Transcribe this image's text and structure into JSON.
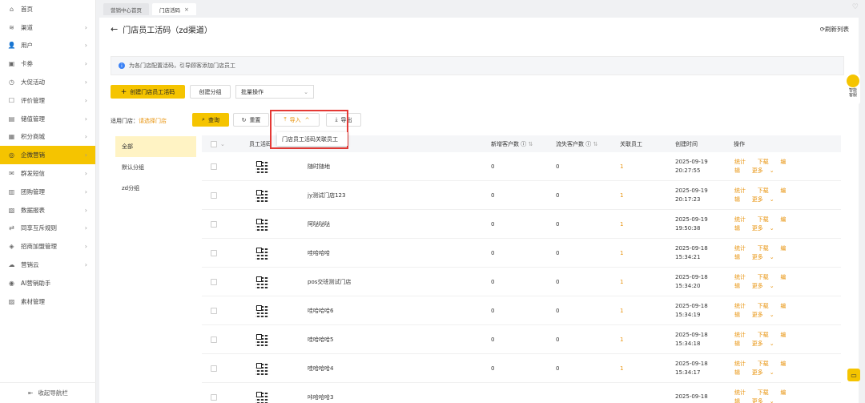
{
  "sidebar": {
    "items": [
      {
        "label": "首页",
        "icon": "home-icon",
        "chevron": false,
        "active": false
      },
      {
        "label": "渠道",
        "icon": "channel-icon",
        "chevron": true,
        "active": false
      },
      {
        "label": "用户",
        "icon": "user-icon",
        "chevron": true,
        "active": false
      },
      {
        "label": "卡券",
        "icon": "coupon-icon",
        "chevron": true,
        "active": false
      },
      {
        "label": "大促活动",
        "icon": "activity-icon",
        "chevron": true,
        "active": false
      },
      {
        "label": "评价管理",
        "icon": "review-icon",
        "chevron": true,
        "active": false
      },
      {
        "label": "储值管理",
        "icon": "wallet-icon",
        "chevron": true,
        "active": false
      },
      {
        "label": "积分商城",
        "icon": "points-icon",
        "chevron": true,
        "active": false
      },
      {
        "label": "企微营销",
        "icon": "wechat-icon",
        "chevron": true,
        "active": true
      },
      {
        "label": "群发短信",
        "icon": "sms-icon",
        "chevron": true,
        "active": false
      },
      {
        "label": "团购管理",
        "icon": "groupbuy-icon",
        "chevron": true,
        "active": false
      },
      {
        "label": "数据报表",
        "icon": "report-icon",
        "chevron": true,
        "active": false
      },
      {
        "label": "同享互斥规则",
        "icon": "rule-icon",
        "chevron": true,
        "active": false
      },
      {
        "label": "招商加盟管理",
        "icon": "franchise-icon",
        "chevron": true,
        "active": false
      },
      {
        "label": "营销云",
        "icon": "cloud-icon",
        "chevron": true,
        "active": false
      },
      {
        "label": "AI营销助手",
        "icon": "ai-icon",
        "chevron": false,
        "active": false
      },
      {
        "label": "素材管理",
        "icon": "material-icon",
        "chevron": false,
        "active": false
      }
    ],
    "footer": "收起导航栏"
  },
  "tabs": [
    {
      "label": "营销中心首页",
      "active": false
    },
    {
      "label": "门店活码",
      "active": true
    }
  ],
  "page": {
    "title": "门店员工活码（zd渠道）",
    "refresh": "刷新列表",
    "info": "为各门店配置活码，引导顾客添加门店员工"
  },
  "toolbar": {
    "create": "创建门店员工活码",
    "create_group": "创建分组",
    "batch": "批量操作",
    "filter_label": "适用门店：",
    "filter_link": "请选择门店",
    "query": "查询",
    "reset": "重置",
    "import": "导入",
    "export": "导出",
    "import_option": "门店员工活码关联员工"
  },
  "groups": [
    "全部",
    "默认分组",
    "zd分组"
  ],
  "table": {
    "headers": [
      "员工活码",
      "",
      "新增客户数",
      "流失客户数",
      "关联员工",
      "创建时间",
      "操作"
    ],
    "rows": [
      {
        "name": "随时随地",
        "new": "0",
        "lost": "0",
        "staff": "1",
        "date": "2025-09-19",
        "time": "20:27:55"
      },
      {
        "name": "jy测试门店123",
        "new": "0",
        "lost": "0",
        "staff": "1",
        "date": "2025-09-19",
        "time": "20:17:23"
      },
      {
        "name": "阿哒哒哒",
        "new": "0",
        "lost": "0",
        "staff": "1",
        "date": "2025-09-19",
        "time": "19:50:38"
      },
      {
        "name": "哇哈哈哈",
        "new": "0",
        "lost": "0",
        "staff": "1",
        "date": "2025-09-18",
        "time": "15:34:21"
      },
      {
        "name": "pos交班测试门店",
        "new": "0",
        "lost": "0",
        "staff": "1",
        "date": "2025-09-18",
        "time": "15:34:20"
      },
      {
        "name": "哇哈哈哈6",
        "new": "0",
        "lost": "0",
        "staff": "1",
        "date": "2025-09-18",
        "time": "15:34:19"
      },
      {
        "name": "哇哈哈哈5",
        "new": "0",
        "lost": "0",
        "staff": "1",
        "date": "2025-09-18",
        "time": "15:34:18"
      },
      {
        "name": "哇哈哈哈4",
        "new": "0",
        "lost": "0",
        "staff": "1",
        "date": "2025-09-18",
        "time": "15:34:17"
      },
      {
        "name": "咔哈哈哈3",
        "new": "",
        "lost": "",
        "staff": "",
        "date": "2025-09-18",
        "time": ""
      }
    ],
    "ops": {
      "stats": "统计",
      "download": "下载",
      "edit_a": "编",
      "edit_b": "辑",
      "more": "更多"
    }
  },
  "widget": {
    "label": "智能客服"
  },
  "colors": {
    "accent": "#f5c400",
    "link": "#e8930c",
    "highlight": "#e53935"
  }
}
